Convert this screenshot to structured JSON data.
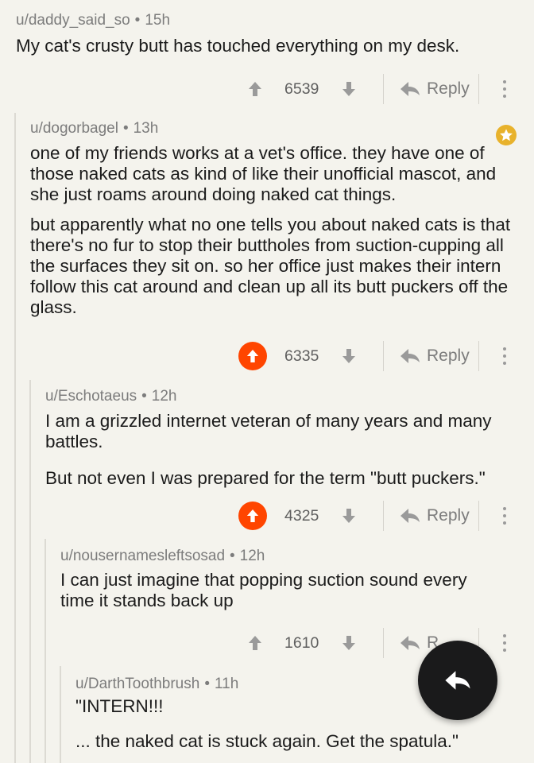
{
  "comments": [
    {
      "user": "u/daddy_said_so",
      "age": "15h",
      "paragraphs": [
        "My cat's crusty butt has touched everything on my desk."
      ],
      "score": "6539",
      "upvoted": false,
      "reply_label": "Reply"
    },
    {
      "user": "u/dogorbagel",
      "age": "13h",
      "paragraphs": [
        "one of my friends works at a vet's office. they have one of those naked cats as kind of like their unofficial mascot, and she just roams around doing naked cat things.",
        "but apparently what no one tells you about naked cats is that there's no fur to stop their buttholes from suction-cupping all the surfaces they sit on. so her office just makes their intern follow this cat around and clean up all its butt puckers off the glass."
      ],
      "score": "6335",
      "upvoted": true,
      "gilded": true,
      "reply_label": "Reply"
    },
    {
      "user": "u/Eschotaeus",
      "age": "12h",
      "paragraphs": [
        "I am a grizzled internet veteran of many years and many battles.",
        "But not even I was prepared for the term \"butt puckers.\""
      ],
      "score": "4325",
      "upvoted": true,
      "reply_label": "Reply"
    },
    {
      "user": "u/nousernamesleftsosad",
      "age": "12h",
      "paragraphs": [
        "I can just imagine that popping suction sound every time it stands back up"
      ],
      "score": "1610",
      "upvoted": false,
      "reply_label": "R"
    },
    {
      "user": "u/DarthToothbrush",
      "age": "11h",
      "paragraphs": [
        "\"INTERN!!!",
        "... the naked cat is stuck again. Get the spatula.\""
      ]
    }
  ],
  "meta_separator": "•",
  "colors": {
    "upvote": "#ff4500",
    "gold": "#e8b22c",
    "fab": "#1a1a1b",
    "thread_line": "#dcdad3"
  },
  "icons": {
    "upvote": "arrow-up-icon",
    "downvote": "arrow-down-icon",
    "reply": "reply-arrow-icon",
    "more": "kebab-menu-icon",
    "gold": "star-award-icon",
    "fab": "reply-fab-icon"
  }
}
